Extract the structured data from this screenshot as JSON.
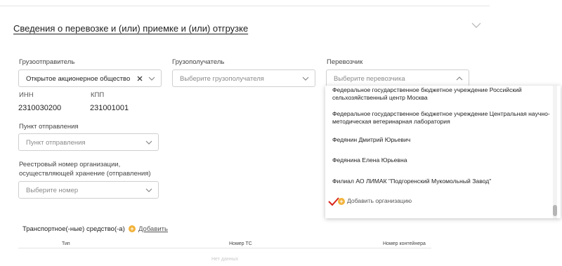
{
  "section": {
    "title": "Сведения о перевозке и (или) приемке и (или) отгрузке"
  },
  "shipper": {
    "label": "Грузоотправитель",
    "value": "Открытое акционерное общество \"Невск",
    "inn_label": "ИНН",
    "inn_value": "2310030200",
    "kpp_label": "КПП",
    "kpp_value": "231001001"
  },
  "consignee": {
    "label": "Грузополучатель",
    "placeholder": "Выберите грузополучателя"
  },
  "carrier": {
    "label": "Перевозчик",
    "placeholder": "Выберите перевозчика",
    "options": [
      "Федеральное государственное бюджетное учреждение Российский сельхозяйственный центр Москва",
      "Федеральное государственное бюджетное учреждение Центральная научно-методическая ветеринарная лаборатория",
      "Федянин Дмитрий Юрьевич",
      "Федянина Елена Юрьевна",
      "Филиал АО ЛИМАК \"Подгоренский Мукомольный Завод\""
    ],
    "add_label": "Добавить организацию"
  },
  "departure": {
    "label": "Пункт отправления",
    "placeholder": "Пункт отправления"
  },
  "registry": {
    "label": "Реестровый номер организации, осуществляющей хранение (отправления)",
    "placeholder": "Выберите номер"
  },
  "transport": {
    "title": "Транспортное(-ные) средство(-а)",
    "add_label": "Добавить",
    "columns": [
      "Тип",
      "Номер ТС",
      "Номер контейнера"
    ],
    "empty_text": "Нет данных"
  },
  "colors": {
    "accent": "#f2b23a",
    "check": "#d9251c"
  },
  "icons": [
    "chevron-down-icon",
    "chevron-up-icon",
    "clear-icon",
    "plus-circle-icon",
    "checkmark-icon"
  ]
}
